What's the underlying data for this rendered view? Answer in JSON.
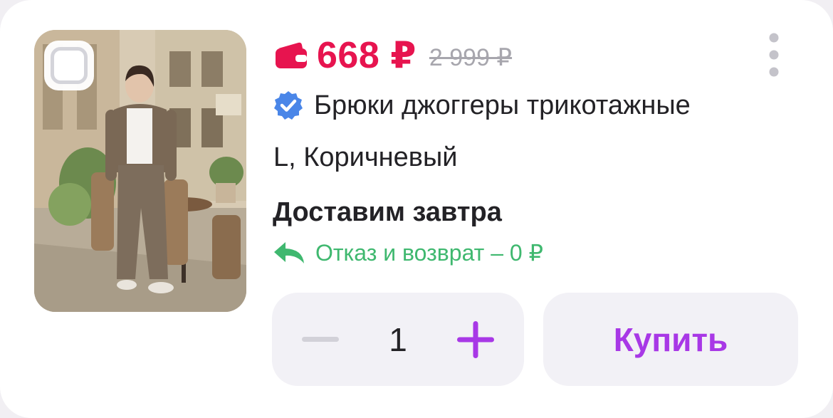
{
  "product": {
    "price": "668 ₽",
    "old_price": "2 999 ₽",
    "title": "Брюки джоггеры трикотажные",
    "variant": "L, Коричневый",
    "delivery": "Доставим завтра",
    "return_policy": "Отказ и возврат – 0 ₽",
    "image_alt": "product-photo"
  },
  "cart": {
    "quantity": "1",
    "buy_label": "Купить"
  },
  "icons": {
    "price_icon": "wallet-icon",
    "title_icon": "verified-check-icon",
    "return_icon": "return-arrow-icon",
    "menu_icon": "more-vertical-icon",
    "minus_icon": "minus-icon",
    "plus_icon": "plus-icon"
  },
  "colors": {
    "price": "#e7144f",
    "old_price": "#a7a6ad",
    "verified": "#4a86e8",
    "return": "#3fb86f",
    "accent": "#a838e6",
    "button_bg": "#f2f1f6"
  }
}
